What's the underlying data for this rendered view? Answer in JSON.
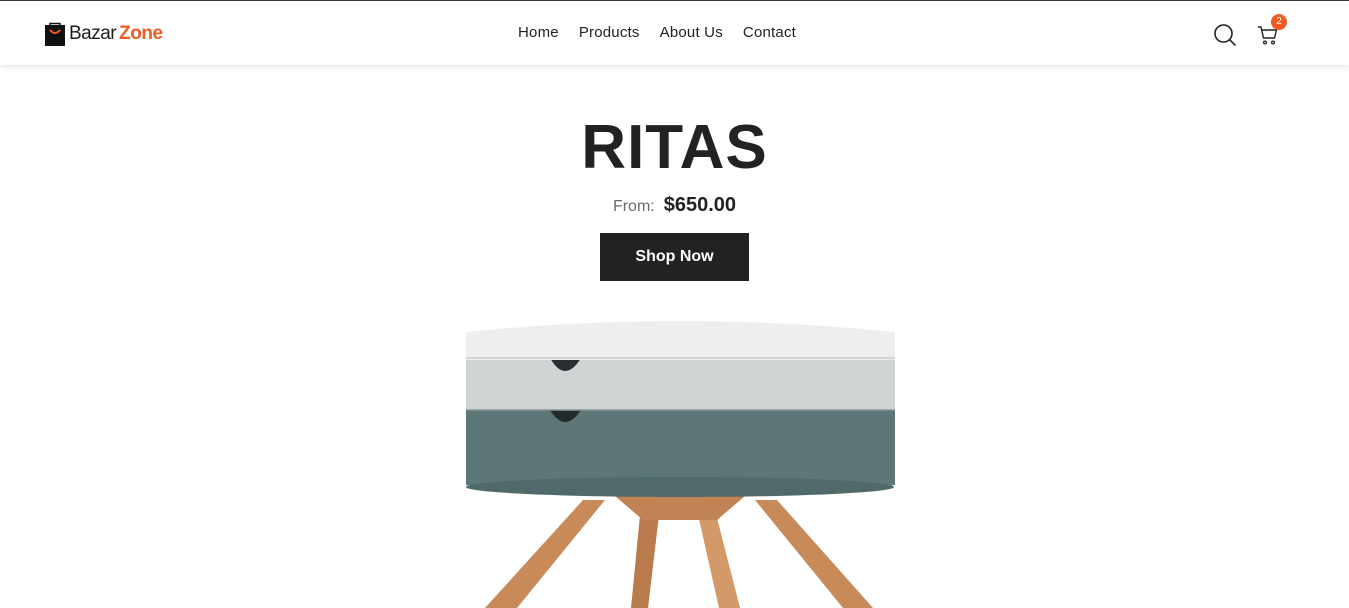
{
  "brand": {
    "name_part_1": "Bazar",
    "name_part_2": "Zone",
    "accent_color": "#f15a22"
  },
  "nav": {
    "items": [
      {
        "label": "Home"
      },
      {
        "label": "Products"
      },
      {
        "label": "About Us"
      },
      {
        "label": "Contact"
      }
    ]
  },
  "header_icons": {
    "search_icon": "search-icon",
    "cart_icon": "cart-icon",
    "cart_count": "2"
  },
  "hero": {
    "title": "RITAS",
    "price_prefix": "From:",
    "price": "$650.00",
    "cta_label": "Shop Now",
    "product_image": "round side table with drawers"
  },
  "colors": {
    "text_dark": "#222222",
    "button_bg": "#222222"
  }
}
